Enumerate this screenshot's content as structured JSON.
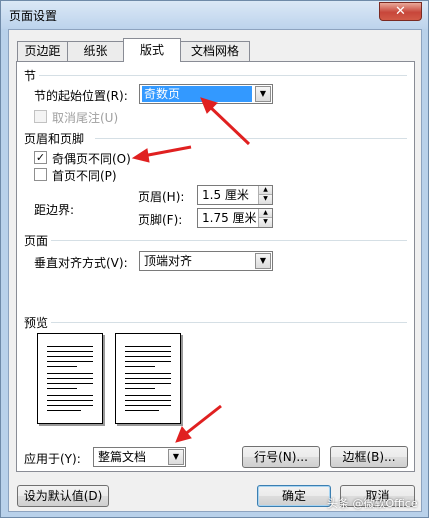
{
  "window": {
    "title": "页面设置",
    "close_label": "✕"
  },
  "tabs": [
    {
      "label": "页边距"
    },
    {
      "label": "纸张"
    },
    {
      "label": "版式"
    },
    {
      "label": "文档网格"
    }
  ],
  "section": {
    "heading": "节",
    "start_label": "节的起始位置(R):",
    "start_value": "奇数页",
    "suppress_endnotes_label": "取消尾注(U)"
  },
  "headers_footers": {
    "heading": "页眉和页脚",
    "odd_even_label": "奇偶页不同(O)",
    "odd_even_checked": true,
    "first_page_label": "首页不同(P)",
    "first_page_checked": false,
    "from_edge_label": "距边界:",
    "header_label": "页眉(H):",
    "header_value": "1.5 厘米",
    "footer_label": "页脚(F):",
    "footer_value": "1.75 厘米"
  },
  "page": {
    "heading": "页面",
    "valign_label": "垂直对齐方式(V):",
    "valign_value": "顶端对齐"
  },
  "preview": {
    "heading": "预览",
    "apply_label": "应用于(Y):",
    "apply_value": "整篇文档",
    "line_numbers_button": "行号(N)...",
    "borders_button": "边框(B)..."
  },
  "footer": {
    "set_default_button": "设为默认值(D)",
    "ok_button": "确定",
    "cancel_button": "取消"
  },
  "watermark": "头条 @微软Office",
  "icons": {
    "check": "✓",
    "down": "▼",
    "up": "▲",
    "close": "close-icon"
  },
  "colors": {
    "selection": "#3399ff",
    "arrow": "#e02020",
    "frame": "#b9d1ea"
  }
}
